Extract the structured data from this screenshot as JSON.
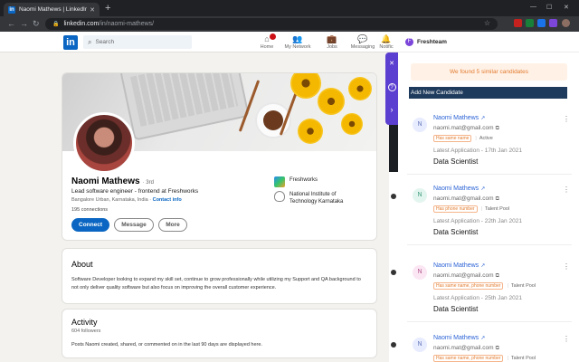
{
  "browser": {
    "tab_title": "Naomi Mathews | LinkedIn",
    "tab_favicon": "in",
    "tab_close": "✕",
    "new_tab": "+",
    "url_domain": "linkedin.com",
    "url_path": "/in/naomi-mathews/",
    "nav": {
      "back": "←",
      "forward": "→",
      "reload": "↻"
    },
    "window_controls": {
      "minimize": "—",
      "maximize": "☐",
      "close": "✕"
    },
    "bookmark_icon": "☆"
  },
  "linkedin": {
    "logo": "in",
    "search_placeholder": "Search",
    "search_icon": "⌕",
    "nav": [
      {
        "label": "Home",
        "icon": "⌂",
        "badge": true
      },
      {
        "label": "My Network",
        "icon": "👥",
        "badge": false
      },
      {
        "label": "Jobs",
        "icon": "💼",
        "badge": false
      },
      {
        "label": "Messaging",
        "icon": "💬",
        "badge": false
      },
      {
        "label": "Notific",
        "icon": "🔔",
        "badge": false
      }
    ],
    "profile": {
      "name": "Naomi Mathews",
      "degree": "· 3rd",
      "headline": "Lead software engineer - frontend at Freshworks",
      "location": "Bangalore Urban, Karnataka, India ·",
      "contact_info": "Contact info",
      "connections": "195 connections",
      "buttons": {
        "connect": "Connect",
        "message": "Message",
        "more": "More"
      },
      "orgs": [
        {
          "name": "Freshworks",
          "logo_color": "#4aa3f0"
        },
        {
          "name": "National Institute of Technology Karnataka",
          "logo_color": "#8a8a8a"
        }
      ]
    },
    "about": {
      "title": "About",
      "text": "Software Developer looking to expand my skill set, continue to grow professionally while utilizing my Support and QA background to not only deliver quality software but also focus on improving the overall customer experience."
    },
    "activity": {
      "title": "Activity",
      "followers": "604 followers",
      "text": "Posts Naomi created, shared, or commented on in the last 90 days are displayed here."
    }
  },
  "freshteam": {
    "title": "Freshteam",
    "logo": "F",
    "found_text": "We found 5 similar candidates",
    "add_new": "Add New Candidate",
    "sidebar_icons": {
      "close": "✕",
      "help": "?",
      "collapse": "›"
    },
    "candidates": [
      {
        "initial": "N",
        "name": "Naomi Mathews",
        "email": "naomi.mat@gmail.com",
        "tags": [
          "Has same name"
        ],
        "statuses": [
          "Active"
        ],
        "latest": "Latest Application - 17th Jan 2021",
        "job": "Data Scientist"
      },
      {
        "initial": "N",
        "name": "Naomi Mathews",
        "email": "naomi.mat@gmail.com",
        "tags": [
          "Has phone number"
        ],
        "statuses": [
          "Talent Pool"
        ],
        "latest": "Latest Application - 22th Jan 2021",
        "job": "Data Scientist"
      },
      {
        "initial": "N",
        "name": "Naomi Mathews",
        "email": "naomi.mat@gmail.com",
        "tags": [
          "Has same name, phone number"
        ],
        "statuses": [
          "Talent Pool"
        ],
        "latest": "Latest Application - 25th Jan 2021",
        "job": "Data Scientist"
      },
      {
        "initial": "N",
        "name": "Naomi Mathews",
        "email": "naomi.mat@gmail.com",
        "tags": [
          "Has same name, phone number"
        ],
        "statuses": [
          "Talent Pool"
        ],
        "latest": "",
        "job": ""
      }
    ]
  }
}
